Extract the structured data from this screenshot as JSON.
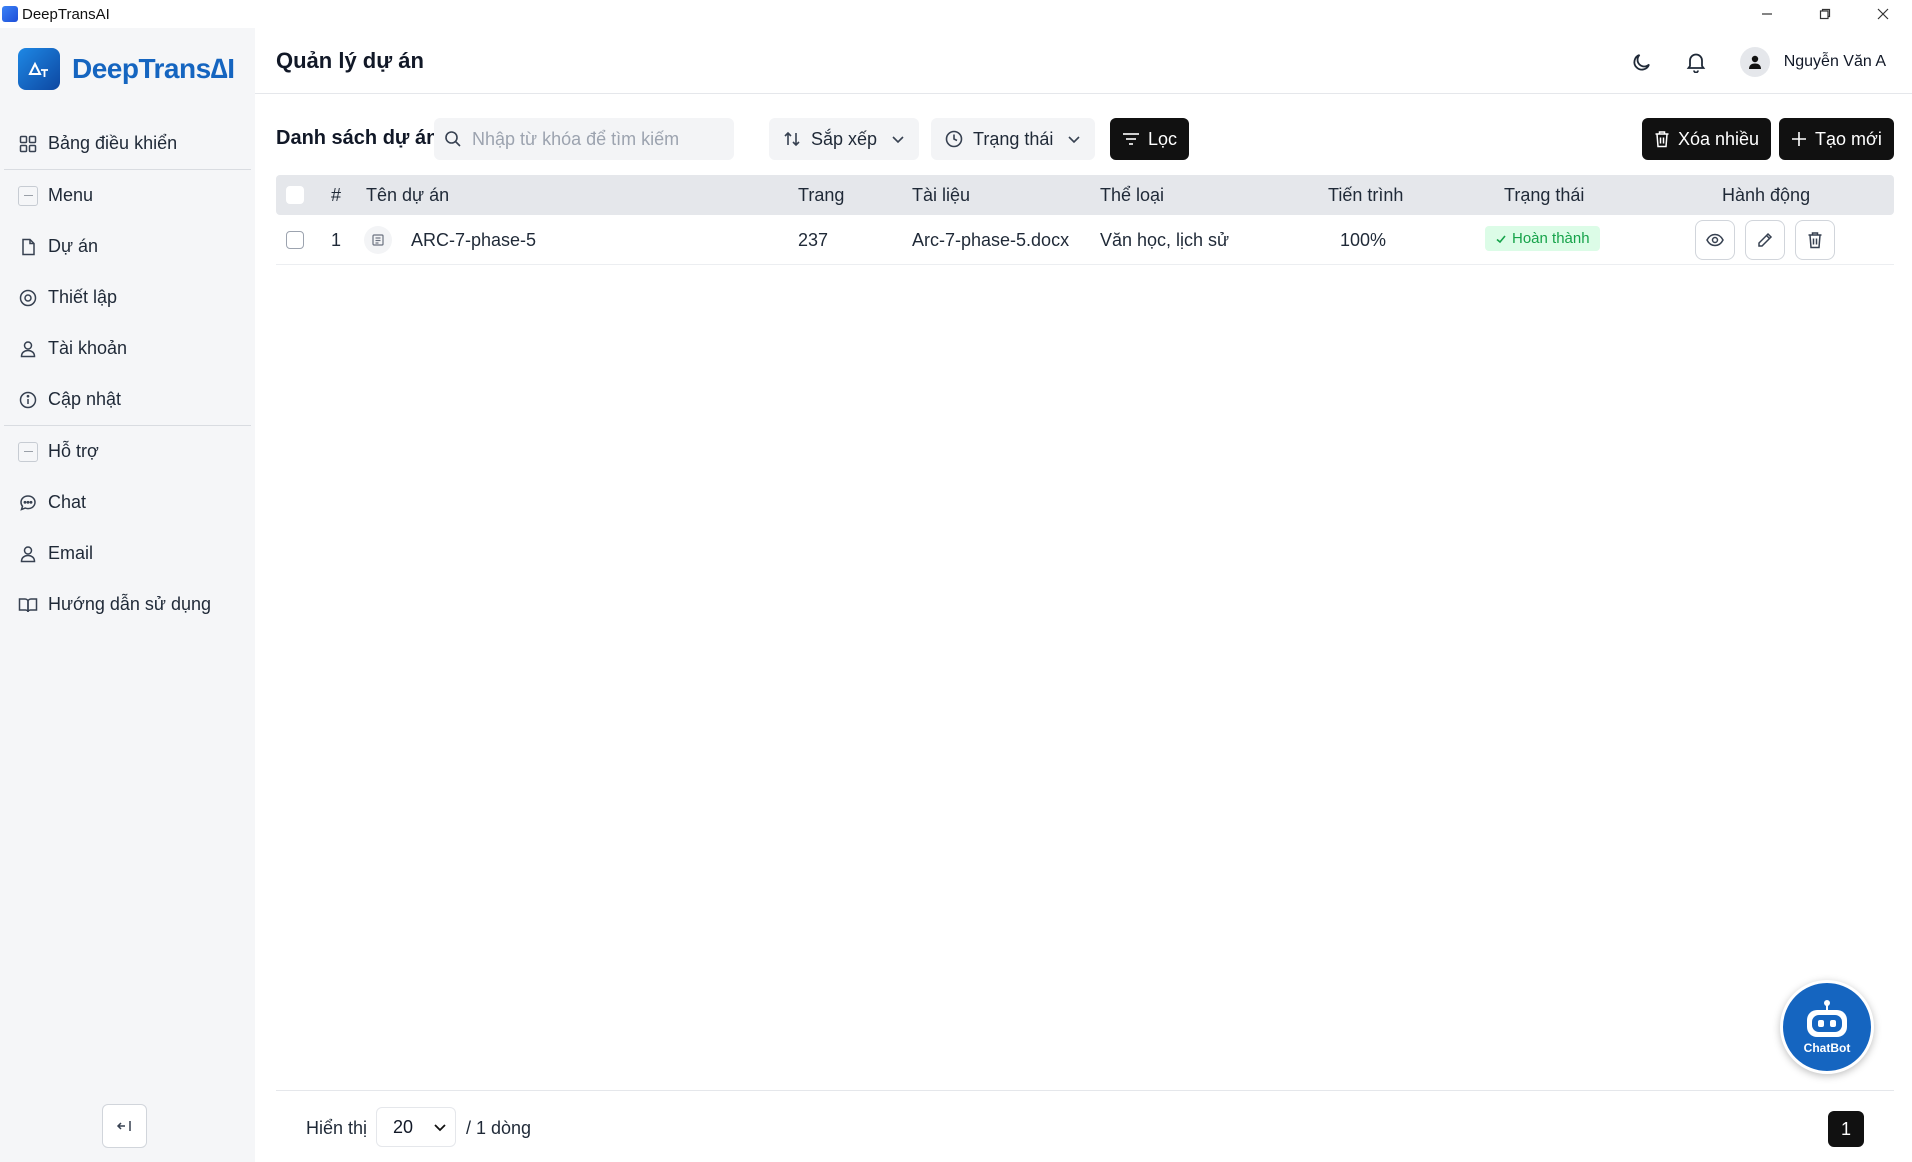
{
  "window": {
    "title": "DeepTransAI"
  },
  "logo": {
    "text": "DeepTrans∆I"
  },
  "sidebar": {
    "items": [
      {
        "label": "Bảng điều khiển",
        "icon": "grid-icon",
        "type": "item"
      },
      {
        "label": "Menu",
        "icon": "minus-box-icon",
        "type": "section"
      },
      {
        "label": "Dự án",
        "icon": "file-icon",
        "type": "item"
      },
      {
        "label": "Thiết lập",
        "icon": "settings-icon",
        "type": "item"
      },
      {
        "label": "Tài khoản",
        "icon": "user-icon",
        "type": "item"
      },
      {
        "label": "Cập nhật",
        "icon": "info-icon",
        "type": "item"
      },
      {
        "label": "Hỗ trợ",
        "icon": "minus-box-icon",
        "type": "section"
      },
      {
        "label": "Chat",
        "icon": "chat-icon",
        "type": "item"
      },
      {
        "label": "Email",
        "icon": "user-icon",
        "type": "item"
      },
      {
        "label": "Hướng dẫn sử dụng",
        "icon": "book-icon",
        "type": "item"
      }
    ]
  },
  "header": {
    "title": "Quản lý dự án",
    "user_name": "Nguyễn Văn A"
  },
  "toolbar": {
    "list_title": "Danh sách dự án",
    "search_placeholder": "Nhập từ khóa để tìm kiếm",
    "sort_label": "Sắp xếp",
    "status_label": "Trạng thái",
    "filter_label": "Lọc",
    "delete_many_label": "Xóa nhiều",
    "create_label": "Tạo mới"
  },
  "table": {
    "columns": [
      "#",
      "Tên dự án",
      "Trang",
      "Tài liệu",
      "Thể loại",
      "Tiến trình",
      "Trạng thái",
      "Hành động"
    ],
    "rows": [
      {
        "index": "1",
        "name": "ARC-7-phase-5",
        "pages": "237",
        "document": "Arc-7-phase-5.docx",
        "category": "Văn học, lịch sử",
        "progress": "100%",
        "status": "Hoàn thành"
      }
    ]
  },
  "footer": {
    "show_label": "Hiển thị",
    "page_size": "20",
    "rows_label": "/ 1 dòng",
    "current_page": "1"
  },
  "chatbot": {
    "label": "ChatBot"
  },
  "colors": {
    "accent": "#111111",
    "brand": "#1565c0",
    "success": "#16a34a"
  }
}
